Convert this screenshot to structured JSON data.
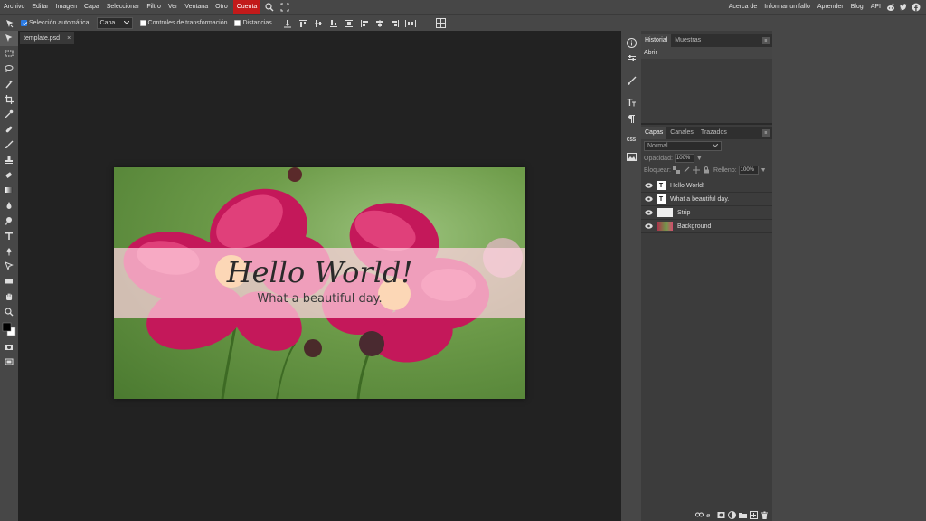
{
  "menubar": {
    "items": [
      "Archivo",
      "Editar",
      "Imagen",
      "Capa",
      "Seleccionar",
      "Filtro",
      "Ver",
      "Ventana",
      "Otro"
    ],
    "account": "Cuenta",
    "right_links": [
      "Acerca de",
      "Informar un fallo",
      "Aprender",
      "Blog",
      "API"
    ],
    "social_icons": [
      "reddit-icon",
      "twitter-icon",
      "facebook-icon"
    ]
  },
  "options": {
    "auto_select_label": "Selección automática",
    "auto_select_checked": true,
    "layer_select_value": "Capa",
    "transform_controls_label": "Controles de transformación",
    "transform_controls_checked": false,
    "distances_label": "Distancias",
    "distances_checked": false,
    "more_label": "..."
  },
  "document": {
    "tab_name": "template.psd",
    "close_label": "×"
  },
  "canvas": {
    "title": "Hello World!",
    "subtitle": "What a beautiful day."
  },
  "rightcol": {
    "css_label": "CSS"
  },
  "history_panel": {
    "tabs": [
      "Historial",
      "Muestras"
    ],
    "items": [
      "Abrir"
    ]
  },
  "layers_panel": {
    "tabs": [
      "Capas",
      "Canales",
      "Trazados"
    ],
    "blend_mode": "Normal",
    "opacity_label": "Opacidad:",
    "opacity_value": "100%",
    "lock_label": "Bloquear:",
    "fill_label": "Relleno:",
    "fill_value": "100%",
    "layers": [
      {
        "name": "Hello World!",
        "type": "text"
      },
      {
        "name": "What a beautiful day.",
        "type": "text"
      },
      {
        "name": "Strip",
        "type": "shape"
      },
      {
        "name": "Background",
        "type": "image"
      }
    ]
  },
  "colors": {
    "menubar_bg": "#474747",
    "account_bg": "#c21a1a",
    "workspace_bg": "#222222",
    "strip_pink": "#ffd2e1",
    "flower_magenta": "#c4185a"
  }
}
